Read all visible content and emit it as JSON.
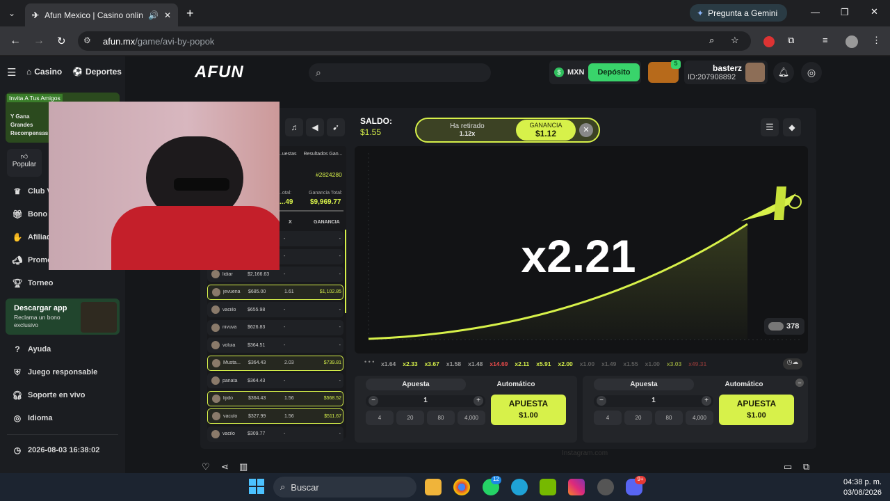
{
  "browser": {
    "tab_title": "Afun Mexico | Casino online",
    "url_domain": "afun.mx",
    "url_path": "/game/avi-by-popok",
    "gemini": "Pregunta a Gemini"
  },
  "nav": {
    "casino": "Casino",
    "deportes": "Deportes",
    "logo": "AFUN"
  },
  "wallet": {
    "currency": "MXN",
    "deposit": "Depósito",
    "badge": "5",
    "username": "basterz",
    "user_id": "ID:207908892"
  },
  "sidebar": {
    "promo_tag": "Invita A Tus Amigos",
    "promo_text": "Y Gana Grandes Recompensas",
    "popular": "Popular",
    "items": [
      "Club VIP",
      "Bono",
      "Afiliados",
      "Promociones",
      "Torneo"
    ],
    "download_title": "Descargar app",
    "download_sub": "Reclama un bono exclusivo",
    "help": [
      "Ayuda",
      "Juego responsable",
      "Soporte en vivo",
      "Idioma"
    ],
    "clock": "2026-08-03 16:38:02"
  },
  "game": {
    "saldo_label": "SALDO:",
    "saldo": "$1.55",
    "withdrawn_label": "Ha retirado",
    "withdrawn_mult": "1.12x",
    "gain_label": "GANANCIA",
    "gain": "$1.12",
    "multiplier": "x2.21",
    "players": "378"
  },
  "history": [
    "x1.64",
    "x2.33",
    "x3.67",
    "x1.58",
    "x1.48",
    "x14.69",
    "x2.11",
    "x5.91",
    "x2.00",
    "x1.00",
    "x1.49",
    "x1.55",
    "x1.00",
    "x3.03",
    "x49.31"
  ],
  "bets_panel": {
    "tab_a": "...uestas",
    "tab_b": "Resultados Gan...",
    "round": "#2824280",
    "total_label": "...otal:",
    "total": "...49",
    "gain_total_label": "Ganancia Total:",
    "gain_total": "$9,969.77",
    "col_x": "X",
    "col_gain": "GANANCIA",
    "rows": [
      {
        "user": "",
        "bet": "",
        "x": "-",
        "gain": "-",
        "hl": false
      },
      {
        "user": "",
        "bet": "",
        "x": "-",
        "gain": "-",
        "hl": false
      },
      {
        "user": "lidiar",
        "bet": "$2,166.63",
        "x": "-",
        "gain": "-",
        "hl": false
      },
      {
        "user": "jevuena",
        "bet": "$685.00",
        "x": "1.61",
        "gain": "$1,102.85",
        "hl": true
      },
      {
        "user": "vaciilo",
        "bet": "$655.98",
        "x": "-",
        "gain": "-",
        "hl": false
      },
      {
        "user": "nivuva",
        "bet": "$626.83",
        "x": "-",
        "gain": "-",
        "hl": false
      },
      {
        "user": "voluia",
        "bet": "$364.51",
        "x": "-",
        "gain": "-",
        "hl": false
      },
      {
        "user": "Musta...",
        "bet": "$364.43",
        "x": "2.03",
        "gain": "$739.81",
        "hl": true
      },
      {
        "user": "panata",
        "bet": "$364.43",
        "x": "-",
        "gain": "-",
        "hl": false
      },
      {
        "user": "lijido",
        "bet": "$364.43",
        "x": "1.56",
        "gain": "$568.52",
        "hl": true
      },
      {
        "user": "vaculo",
        "bet": "$327.99",
        "x": "1.56",
        "gain": "$511.67",
        "hl": true
      },
      {
        "user": "vacilo",
        "bet": "$309.77",
        "x": "-",
        "gain": "-",
        "hl": false
      }
    ]
  },
  "bet": {
    "tab_bet": "Apuesta",
    "tab_auto": "Automático",
    "amount": "1",
    "minus": "−",
    "plus": "+",
    "quick": [
      "4",
      "20",
      "80",
      "4,000"
    ],
    "button": "APUESTA",
    "button_amount": "$1.00"
  },
  "footer": {
    "watermark": "Instagram.com"
  },
  "taskbar": {
    "search": "Buscar",
    "time": "04:38 p. m.",
    "date": "03/08/2026",
    "badge_whatsapp": "12",
    "badge_discord": "9+"
  },
  "colors": {
    "accent": "#d7f14a",
    "graph_bg": "#121315",
    "red": "#e84a4a"
  }
}
